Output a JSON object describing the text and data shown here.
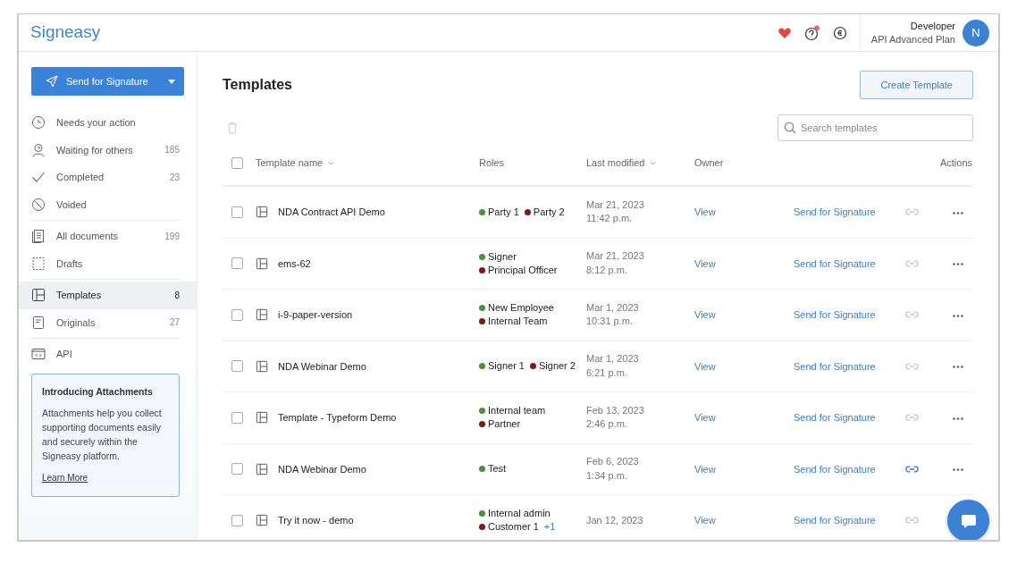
{
  "header": {
    "logo": "Signeasy",
    "help_notification": true,
    "user": {
      "name": "Developer",
      "plan": "API Advanced Plan",
      "initial": "N"
    }
  },
  "sidebar": {
    "primary_button": "Send for Signature",
    "items": [
      {
        "kind": "clock",
        "label": "Needs your action",
        "selected": false,
        "divider_above": false
      },
      {
        "kind": "person",
        "label": "Waiting for others",
        "count": "185",
        "selected": false,
        "divider_above": false
      },
      {
        "kind": "check",
        "label": "Completed",
        "count": "23",
        "selected": false,
        "divider_above": false
      },
      {
        "kind": "void",
        "label": "Voided",
        "selected": false,
        "divider_above": false
      },
      {
        "kind": "docs",
        "label": "All documents",
        "count": "199",
        "selected": false,
        "divider_above": true
      },
      {
        "kind": "draft",
        "label": "Drafts",
        "selected": false,
        "divider_above": false
      },
      {
        "kind": "template",
        "label": "Templates",
        "count": "8",
        "selected": true,
        "divider_above": true
      },
      {
        "kind": "original",
        "label": "Originals",
        "count": "27",
        "selected": false,
        "divider_above": false
      },
      {
        "kind": "api",
        "label": "API",
        "selected": false,
        "divider_above": true
      }
    ],
    "promo": {
      "title": "Introducing Attachments",
      "text": "Attachments help you collect supporting documents easily and securely within the Signeasy platform.",
      "link": "Learn More"
    }
  },
  "page": {
    "title": "Templates",
    "create_button": "Create Template",
    "search": {
      "placeholder": "Search templates"
    }
  },
  "table": {
    "select_all_checked": false,
    "columns": [
      "Template name",
      "Roles",
      "Last modified",
      "Owner",
      "Actions"
    ],
    "rows": [
      {
        "name": "NDA Contract API Demo",
        "roles": [
          {
            "name": "Party 1",
            "color": "#4e8f3e"
          },
          {
            "name": "Party 2",
            "color": "#7b1c1c"
          }
        ],
        "date": "Mar 21, 2023",
        "time": "11:42 p.m.",
        "owner": "View",
        "action": "Send for Signature",
        "link_active": false,
        "menu": true,
        "checked": false
      },
      {
        "name": "ems-62",
        "roles": [
          {
            "name": "Signer",
            "color": "#4e8f3e"
          },
          {
            "name": "Principal Officer",
            "color": "#7b1c1c"
          }
        ],
        "date": "Mar 21, 2023",
        "time": "8:12 p.m.",
        "owner": "View",
        "action": "Send for Signature",
        "link_active": false,
        "menu": true,
        "checked": false
      },
      {
        "name": "i-9-paper-version",
        "roles": [
          {
            "name": "New Employee",
            "color": "#4e8f3e"
          },
          {
            "name": "Internal Team",
            "color": "#7b1c1c"
          }
        ],
        "date": "Mar 1, 2023",
        "time": "10:31 p.m.",
        "owner": "View",
        "action": "Send for Signature",
        "link_active": false,
        "menu": true,
        "checked": false
      },
      {
        "name": "NDA Webinar Demo",
        "roles": [
          {
            "name": "Signer 1",
            "color": "#4e8f3e"
          },
          {
            "name": "Signer 2",
            "color": "#7b1c1c"
          }
        ],
        "date": "Mar 1, 2023",
        "time": "6:21 p.m.",
        "owner": "View",
        "action": "Send for Signature",
        "link_active": false,
        "menu": true,
        "checked": false
      },
      {
        "name": "Template - Typeform Demo",
        "roles": [
          {
            "name": "Internal team",
            "color": "#4e8f3e"
          },
          {
            "name": "Partner",
            "color": "#7b1c1c"
          }
        ],
        "date": "Feb 13, 2023",
        "time": "2:46 p.m.",
        "owner": "View",
        "action": "Send for Signature",
        "link_active": false,
        "menu": true,
        "checked": false
      },
      {
        "name": "NDA Webinar Demo",
        "roles": [
          {
            "name": "Test",
            "color": "#4e8f3e"
          }
        ],
        "date": "Feb 6, 2023",
        "time": "1:34 p.m.",
        "owner": "View",
        "action": "Send for Signature",
        "link_active": true,
        "menu": true,
        "checked": false
      },
      {
        "name": "Try it now - demo",
        "roles": [
          {
            "name": "Internal admin",
            "color": "#4e8f3e"
          },
          {
            "name": "Customer 1",
            "color": "#7b1c1c"
          }
        ],
        "more_roles": "+1",
        "date": "Jan 12, 2023",
        "owner": "View",
        "action": "Send for Signature",
        "link_active": false,
        "menu": false,
        "checked": false
      }
    ]
  }
}
